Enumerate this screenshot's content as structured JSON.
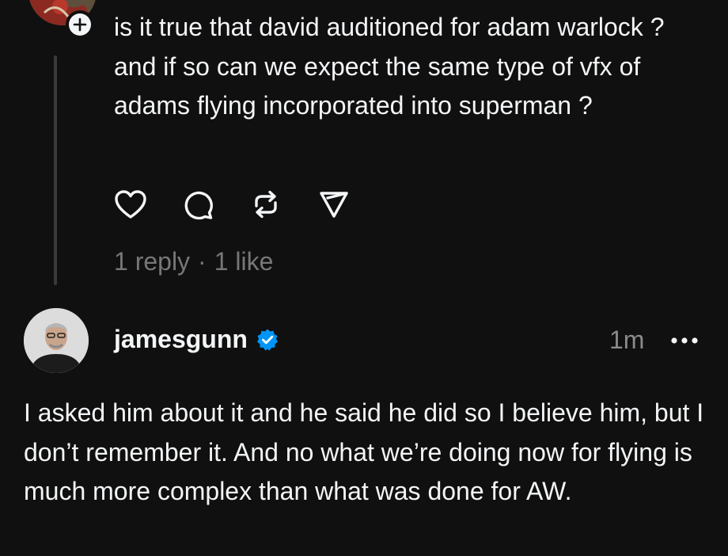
{
  "parent_post": {
    "text": "is it true that david auditioned for adam warlock ? and if so can we expect the same type of vfx of adams flying incorporated into superman ?",
    "actions": [
      "heart-icon",
      "comment-icon",
      "repost-icon",
      "share-icon"
    ],
    "stats": {
      "replies": "1 reply",
      "separator": "·",
      "likes": "1 like"
    }
  },
  "reply_post": {
    "username": "jamesgunn",
    "verified": true,
    "timestamp": "1m",
    "more_icon": "more-icon",
    "text": "I asked him about it and he said he did so I believe him, but I don’t remember it. And no what we’re doing now for flying is much more complex than what was done for AW."
  },
  "colors": {
    "background": "#101010",
    "text_primary": "#f3f5f7",
    "text_secondary": "#777777",
    "thread_line": "#3a3a3a",
    "verified_blue": "#0095f6"
  }
}
